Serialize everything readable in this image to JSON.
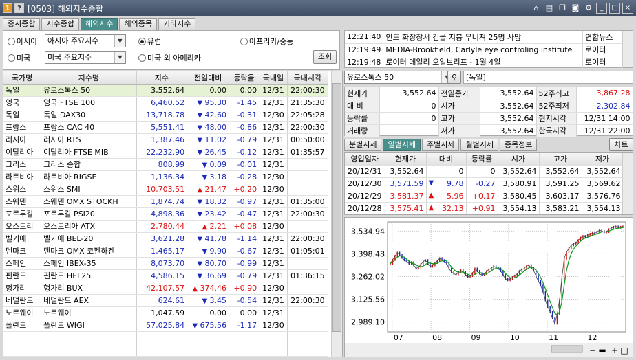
{
  "window": {
    "badge1": "1",
    "badge2": "?",
    "title": "[0503] 해외지수종합",
    "icons": [
      "tool-icon",
      "doc-icon",
      "copy-icon",
      "camera-icon",
      "gear-icon",
      "minimize-icon",
      "maximize-icon",
      "close-icon"
    ]
  },
  "tabs_main": [
    {
      "label": "증시종합",
      "active": false
    },
    {
      "label": "지수종합",
      "active": false
    },
    {
      "label": "해외지수",
      "active": true
    },
    {
      "label": "해외종목",
      "active": false
    },
    {
      "label": "기타지수",
      "active": false
    }
  ],
  "filter": {
    "asia_label": "아시아",
    "asia_value": "아시아 주요지수",
    "europe_label": "유럽",
    "africa_label": "아프리카/중동",
    "usa_label": "미국",
    "usa_value": "미국 주요지수",
    "america_label": "미국 외 아메리카",
    "query_button": "조회",
    "selected": "europe"
  },
  "index_table": {
    "headers": [
      "국가명",
      "지수명",
      "지수",
      "전일대비",
      "등락율",
      "국내일",
      "국내시각"
    ],
    "rows": [
      {
        "country": "독일",
        "name": "유로스톡스 50",
        "index": "3,552.64",
        "dir": "flat",
        "change": "0.00",
        "rate": "0.00",
        "date": "12/31",
        "time": "22:00:30"
      },
      {
        "country": "영국",
        "name": "영국 FTSE 100",
        "index": "6,460.52",
        "dir": "down",
        "change": "95.30",
        "rate": "-1.45",
        "date": "12/31",
        "time": "21:35:30"
      },
      {
        "country": "독일",
        "name": "독일 DAX30",
        "index": "13,718.78",
        "dir": "down",
        "change": "42.60",
        "rate": "-0.31",
        "date": "12/30",
        "time": "22:05:28"
      },
      {
        "country": "프랑스",
        "name": "프랑스 CAC 40",
        "index": "5,551.41",
        "dir": "down",
        "change": "48.00",
        "rate": "-0.86",
        "date": "12/31",
        "time": "22:00:30"
      },
      {
        "country": "러시아",
        "name": "러시아 RTS",
        "index": "1,387.46",
        "dir": "down",
        "change": "11.02",
        "rate": "-0.79",
        "date": "12/31",
        "time": "00:50:00"
      },
      {
        "country": "이탈리아",
        "name": "이탈리아 FTSE MIB",
        "index": "22,232.90",
        "dir": "down",
        "change": "26.45",
        "rate": "-0.12",
        "date": "12/31",
        "time": "01:35:57"
      },
      {
        "country": "그리스",
        "name": "그리스 종합",
        "index": "808.99",
        "dir": "down",
        "change": "0.09",
        "rate": "-0.01",
        "date": "12/31",
        "time": ""
      },
      {
        "country": "라트비아",
        "name": "라트비아 RIGSE",
        "index": "1,136.34",
        "dir": "down",
        "change": "3.18",
        "rate": "-0.28",
        "date": "12/30",
        "time": ""
      },
      {
        "country": "스위스",
        "name": "스위스 SMI",
        "index": "10,703.51",
        "dir": "up",
        "change": "21.47",
        "rate": "+0.20",
        "date": "12/30",
        "time": ""
      },
      {
        "country": "스웨덴",
        "name": "스웨덴 OMX STOCKH",
        "index": "1,874.74",
        "dir": "down",
        "change": "18.32",
        "rate": "-0.97",
        "date": "12/31",
        "time": "01:35:00"
      },
      {
        "country": "포르투갈",
        "name": "포르투갈 PSI20",
        "index": "4,898.36",
        "dir": "down",
        "change": "23.42",
        "rate": "-0.47",
        "date": "12/31",
        "time": "22:00:30"
      },
      {
        "country": "오스트리",
        "name": "오스트리아 ATX",
        "index": "2,780.44",
        "dir": "up",
        "change": "2.21",
        "rate": "+0.08",
        "date": "12/30",
        "time": ""
      },
      {
        "country": "벨기에",
        "name": "벨기에 BEL-20",
        "index": "3,621.28",
        "dir": "down",
        "change": "41.78",
        "rate": "-1.14",
        "date": "12/31",
        "time": "22:00:30"
      },
      {
        "country": "덴마크",
        "name": "덴마크 OMX 코펜하겐",
        "index": "1,465.17",
        "dir": "down",
        "change": "9.90",
        "rate": "-0.67",
        "date": "12/31",
        "time": "01:05:01"
      },
      {
        "country": "스페인",
        "name": "스페인 IBEX-35",
        "index": "8,073.70",
        "dir": "down",
        "change": "80.70",
        "rate": "-0.99",
        "date": "12/31",
        "time": ""
      },
      {
        "country": "핀란드",
        "name": "핀란드 HEL25",
        "index": "4,586.15",
        "dir": "down",
        "change": "36.69",
        "rate": "-0.79",
        "date": "12/31",
        "time": "01:36:15"
      },
      {
        "country": "헝가리",
        "name": "헝가리 BUX",
        "index": "42,107.57",
        "dir": "up",
        "change": "374.46",
        "rate": "+0.90",
        "date": "12/30",
        "time": ""
      },
      {
        "country": "네덜란드",
        "name": "네덜란드 AEX",
        "index": "624.61",
        "dir": "down",
        "change": "3.45",
        "rate": "-0.54",
        "date": "12/31",
        "time": "22:00:30"
      },
      {
        "country": "노르웨이",
        "name": "노르웨이",
        "index": "1,047.59",
        "dir": "flat",
        "change": "0.00",
        "rate": "0.00",
        "date": "12/31",
        "time": ""
      },
      {
        "country": "폴란드",
        "name": "폴란드 WIGI",
        "index": "57,025.84",
        "dir": "down",
        "change": "675.56",
        "rate": "-1.17",
        "date": "12/30",
        "time": ""
      }
    ]
  },
  "news": [
    {
      "time": "12:21:40",
      "title": "인도 화장장서 건물 지붕 무너져 25명 사망",
      "source": "연합뉴스"
    },
    {
      "time": "12:19:49",
      "title": "MEDIA-Brookfield, Carlyle eye controling institute",
      "source": "로이터"
    },
    {
      "time": "12:19:48",
      "title": "로이터 데일리 오일브리프 - 1월 4일",
      "source": "로이터"
    }
  ],
  "selector": {
    "value": "유로스톡스 50",
    "country": "[독일]"
  },
  "quote": [
    [
      {
        "l": "현재가",
        "v": "3,552.64",
        "c": ""
      },
      {
        "l": "전일종가",
        "v": "3,552.64",
        "c": ""
      },
      {
        "l": "52주최고",
        "v": "3,867.28",
        "c": "up"
      }
    ],
    [
      {
        "l": "대 비",
        "v": "0",
        "c": ""
      },
      {
        "l": "시가",
        "v": "3,552.64",
        "c": ""
      },
      {
        "l": "52주최저",
        "v": "2,302.84",
        "c": "dn"
      }
    ],
    [
      {
        "l": "등락률",
        "v": "0",
        "c": ""
      },
      {
        "l": "고가",
        "v": "3,552.64",
        "c": ""
      },
      {
        "l": "현지시각",
        "v": "12/31 14:00",
        "c": ""
      }
    ],
    [
      {
        "l": "거래량",
        "v": "",
        "c": ""
      },
      {
        "l": "저가",
        "v": "3,552.64",
        "c": ""
      },
      {
        "l": "한국시각",
        "v": "12/31 22:00",
        "c": ""
      }
    ]
  ],
  "sub_tabs": [
    {
      "label": "분별시세",
      "active": false
    },
    {
      "label": "일별시세",
      "active": true
    },
    {
      "label": "주별시세",
      "active": false
    },
    {
      "label": "월별시세",
      "active": false
    },
    {
      "label": "종목정보",
      "active": false
    }
  ],
  "chart_button": "차트",
  "history": {
    "headers": [
      "영업일자",
      "현재가",
      "대비",
      "등락률",
      "시가",
      "고가",
      "저가"
    ],
    "rows": [
      {
        "date": "20/12/31",
        "price": "3,552.64",
        "dir": "flat",
        "change": "0",
        "rate": "0",
        "open": "3,552.64",
        "high": "3,552.64",
        "low": "3,552.64",
        "cls": ""
      },
      {
        "date": "20/12/30",
        "price": "3,571.59",
        "dir": "down",
        "change": "9.78",
        "rate": "-0.27",
        "open": "3,580.91",
        "high": "3,591.25",
        "low": "3,569.62",
        "cls": "dn"
      },
      {
        "date": "20/12/29",
        "price": "3,581.37",
        "dir": "up",
        "change": "5.96",
        "rate": "+0.17",
        "open": "3,580.45",
        "high": "3,603.17",
        "low": "3,576.76",
        "cls": "up"
      },
      {
        "date": "20/12/28",
        "price": "3,575.41",
        "dir": "up",
        "change": "32.13",
        "rate": "+0.91",
        "open": "3,554.13",
        "high": "3,583.21",
        "low": "3,554.13",
        "cls": "up"
      }
    ]
  },
  "chart_data": {
    "type": "line",
    "x_ticks": [
      "07",
      "08",
      "09",
      "10",
      "11",
      "12"
    ],
    "y_ticks": [
      3534.94,
      3398.48,
      3262.02,
      3125.56,
      2989.1
    ],
    "ylim": [
      2930,
      3590
    ],
    "series": [
      {
        "kind": "price",
        "values": [
          3340,
          3362,
          3385,
          3405,
          3392,
          3375,
          3360,
          3352,
          3340,
          3348,
          3330,
          3310,
          3318,
          3335,
          3352,
          3360,
          3340,
          3322,
          3330,
          3345,
          3355,
          3372,
          3360,
          3350,
          3340,
          3310,
          3290,
          3280,
          3272,
          3290,
          3300,
          3288,
          3270,
          3260,
          3266,
          3282,
          3310,
          3295,
          3280,
          3270,
          3275,
          3294,
          3305,
          3312,
          3325,
          3315,
          3310,
          3295,
          3270,
          3250,
          3240,
          3248,
          3258,
          3267,
          3277,
          3296,
          3305,
          3310,
          3325,
          3330,
          3315,
          3298,
          3265,
          3235,
          3208,
          3170,
          3120,
          3080,
          3052,
          3010,
          2980,
          3035,
          3120,
          3250,
          3370,
          3410,
          3430,
          3450,
          3460,
          3465,
          3480,
          3495,
          3505,
          3500,
          3510,
          3518,
          3522,
          3520,
          3530,
          3540,
          3535,
          3528,
          3530,
          3545,
          3552,
          3560,
          3562,
          3556,
          3560,
          3562
        ]
      },
      {
        "kind": "moving-average",
        "values": [
          3340,
          3350,
          3362,
          3378,
          3386,
          3384,
          3377,
          3366,
          3354,
          3346,
          3340,
          3333,
          3325,
          3320,
          3325,
          3335,
          3345,
          3342,
          3340,
          3338,
          3342,
          3350,
          3357,
          3360,
          3355,
          3340,
          3320,
          3305,
          3293,
          3288,
          3288,
          3290,
          3284,
          3276,
          3270,
          3268,
          3275,
          3283,
          3287,
          3283,
          3276,
          3278,
          3287,
          3297,
          3306,
          3312,
          3314,
          3310,
          3298,
          3282,
          3266,
          3255,
          3252,
          3255,
          3260,
          3270,
          3283,
          3295,
          3306,
          3315,
          3318,
          3313,
          3300,
          3280,
          3255,
          3225,
          3190,
          3150,
          3112,
          3075,
          3042,
          3030,
          3050,
          3110,
          3210,
          3300,
          3360,
          3400,
          3428,
          3445,
          3460,
          3475,
          3487,
          3493,
          3498,
          3503,
          3510,
          3514,
          3518,
          3525,
          3530,
          3530,
          3531,
          3535,
          3540,
          3545,
          3550,
          3552,
          3554,
          3556
        ]
      }
    ],
    "colors": {
      "up": "#d11111",
      "down": "#1a2ab8",
      "moving_average": "#0a9a1a",
      "price_line": "#444444"
    }
  }
}
